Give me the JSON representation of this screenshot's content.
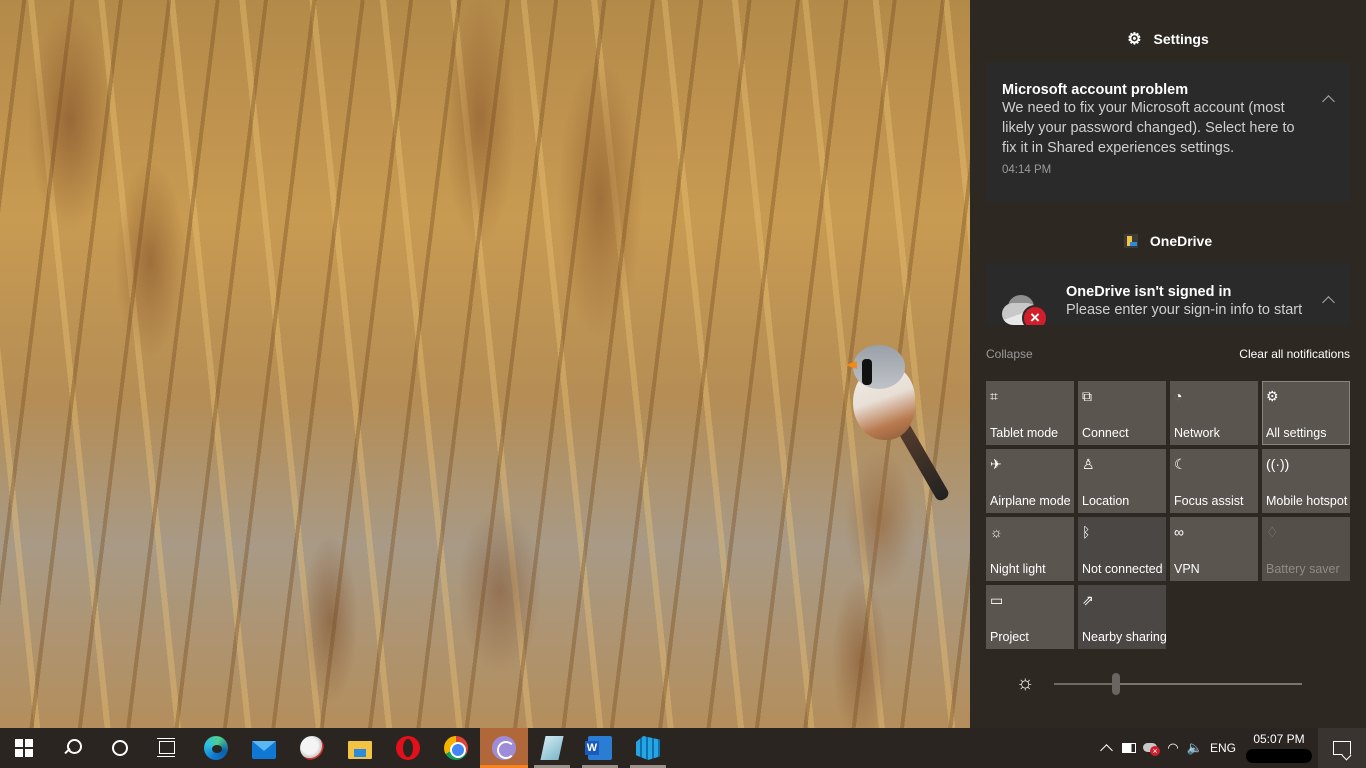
{
  "action_center": {
    "groups": [
      {
        "app_name": "Settings",
        "icon": "gear-icon",
        "notification": {
          "title": "Microsoft account problem",
          "body": "We need to fix your Microsoft account (most likely your password changed). Select here to fix it in Shared experiences settings.",
          "time": "04:14 PM"
        }
      },
      {
        "app_name": "OneDrive",
        "icon": "onedrive-app-icon",
        "notification": {
          "title": "OneDrive isn't signed in",
          "body": "Please enter your sign-in info to start",
          "icon": "onedrive-error-icon"
        }
      }
    ],
    "collapse_label": "Collapse",
    "clear_all_label": "Clear all notifications",
    "quick_actions": [
      {
        "label": "Tablet mode",
        "icon": "tablet-mode-icon",
        "glyph": "⌗",
        "state": "on"
      },
      {
        "label": "Connect",
        "icon": "connect-icon",
        "glyph": "⧉",
        "state": "on"
      },
      {
        "label": "Network",
        "icon": "network-icon",
        "glyph": "◔",
        "state": "on"
      },
      {
        "label": "All settings",
        "icon": "gear-icon",
        "glyph": "⚙",
        "state": "selected"
      },
      {
        "label": "Airplane mode",
        "icon": "airplane-icon",
        "glyph": "✈",
        "state": "on"
      },
      {
        "label": "Location",
        "icon": "location-icon",
        "glyph": "♙",
        "state": "on"
      },
      {
        "label": "Focus assist",
        "icon": "moon-icon",
        "glyph": "☾",
        "state": "on"
      },
      {
        "label": "Mobile hotspot",
        "icon": "hotspot-icon",
        "glyph": "((·))",
        "state": "on"
      },
      {
        "label": "Night light",
        "icon": "night-light-icon",
        "glyph": "☼",
        "state": "on"
      },
      {
        "label": "Not connected",
        "icon": "bluetooth-icon",
        "glyph": "ᛒ",
        "state": "off"
      },
      {
        "label": "VPN",
        "icon": "vpn-icon",
        "glyph": "∞",
        "state": "on"
      },
      {
        "label": "Battery saver",
        "icon": "battery-saver-icon",
        "glyph": "♢",
        "state": "disabled"
      },
      {
        "label": "Project",
        "icon": "project-icon",
        "glyph": "▭",
        "state": "on"
      },
      {
        "label": "Nearby sharing",
        "icon": "nearby-sharing-icon",
        "glyph": "⇗",
        "state": "off"
      }
    ],
    "brightness": {
      "icon": "brightness-icon",
      "glyph": "☼",
      "value_percent": 25
    }
  },
  "taskbar": {
    "items": [
      {
        "name": "start-button",
        "icon": "windows-logo-icon"
      },
      {
        "name": "search-button",
        "icon": "search-icon"
      },
      {
        "name": "cortana-button",
        "icon": "cortana-icon"
      },
      {
        "name": "task-view-button",
        "icon": "task-view-icon"
      },
      {
        "name": "edge-button",
        "icon": "edge-icon",
        "open": false
      },
      {
        "name": "mail-button",
        "icon": "mail-icon",
        "open": false
      },
      {
        "name": "snipping-tool-button",
        "icon": "snipping-tool-icon",
        "open": false
      },
      {
        "name": "file-explorer-button",
        "icon": "file-explorer-icon",
        "open": false
      },
      {
        "name": "opera-button",
        "icon": "opera-icon",
        "open": false
      },
      {
        "name": "chrome-button",
        "icon": "chrome-icon",
        "open": false
      },
      {
        "name": "bittorrent-button",
        "icon": "bittorrent-icon",
        "open": true,
        "active": true
      },
      {
        "name": "notepad-button",
        "icon": "notepad-icon",
        "open": true
      },
      {
        "name": "word-button",
        "icon": "word-icon",
        "open": true
      },
      {
        "name": "box-app-button",
        "icon": "box-app-icon",
        "open": true
      }
    ],
    "tray": {
      "language": "ENG",
      "time": "05:07 PM",
      "wifi_glyph": "◠",
      "volume_glyph": "🔈"
    }
  }
}
